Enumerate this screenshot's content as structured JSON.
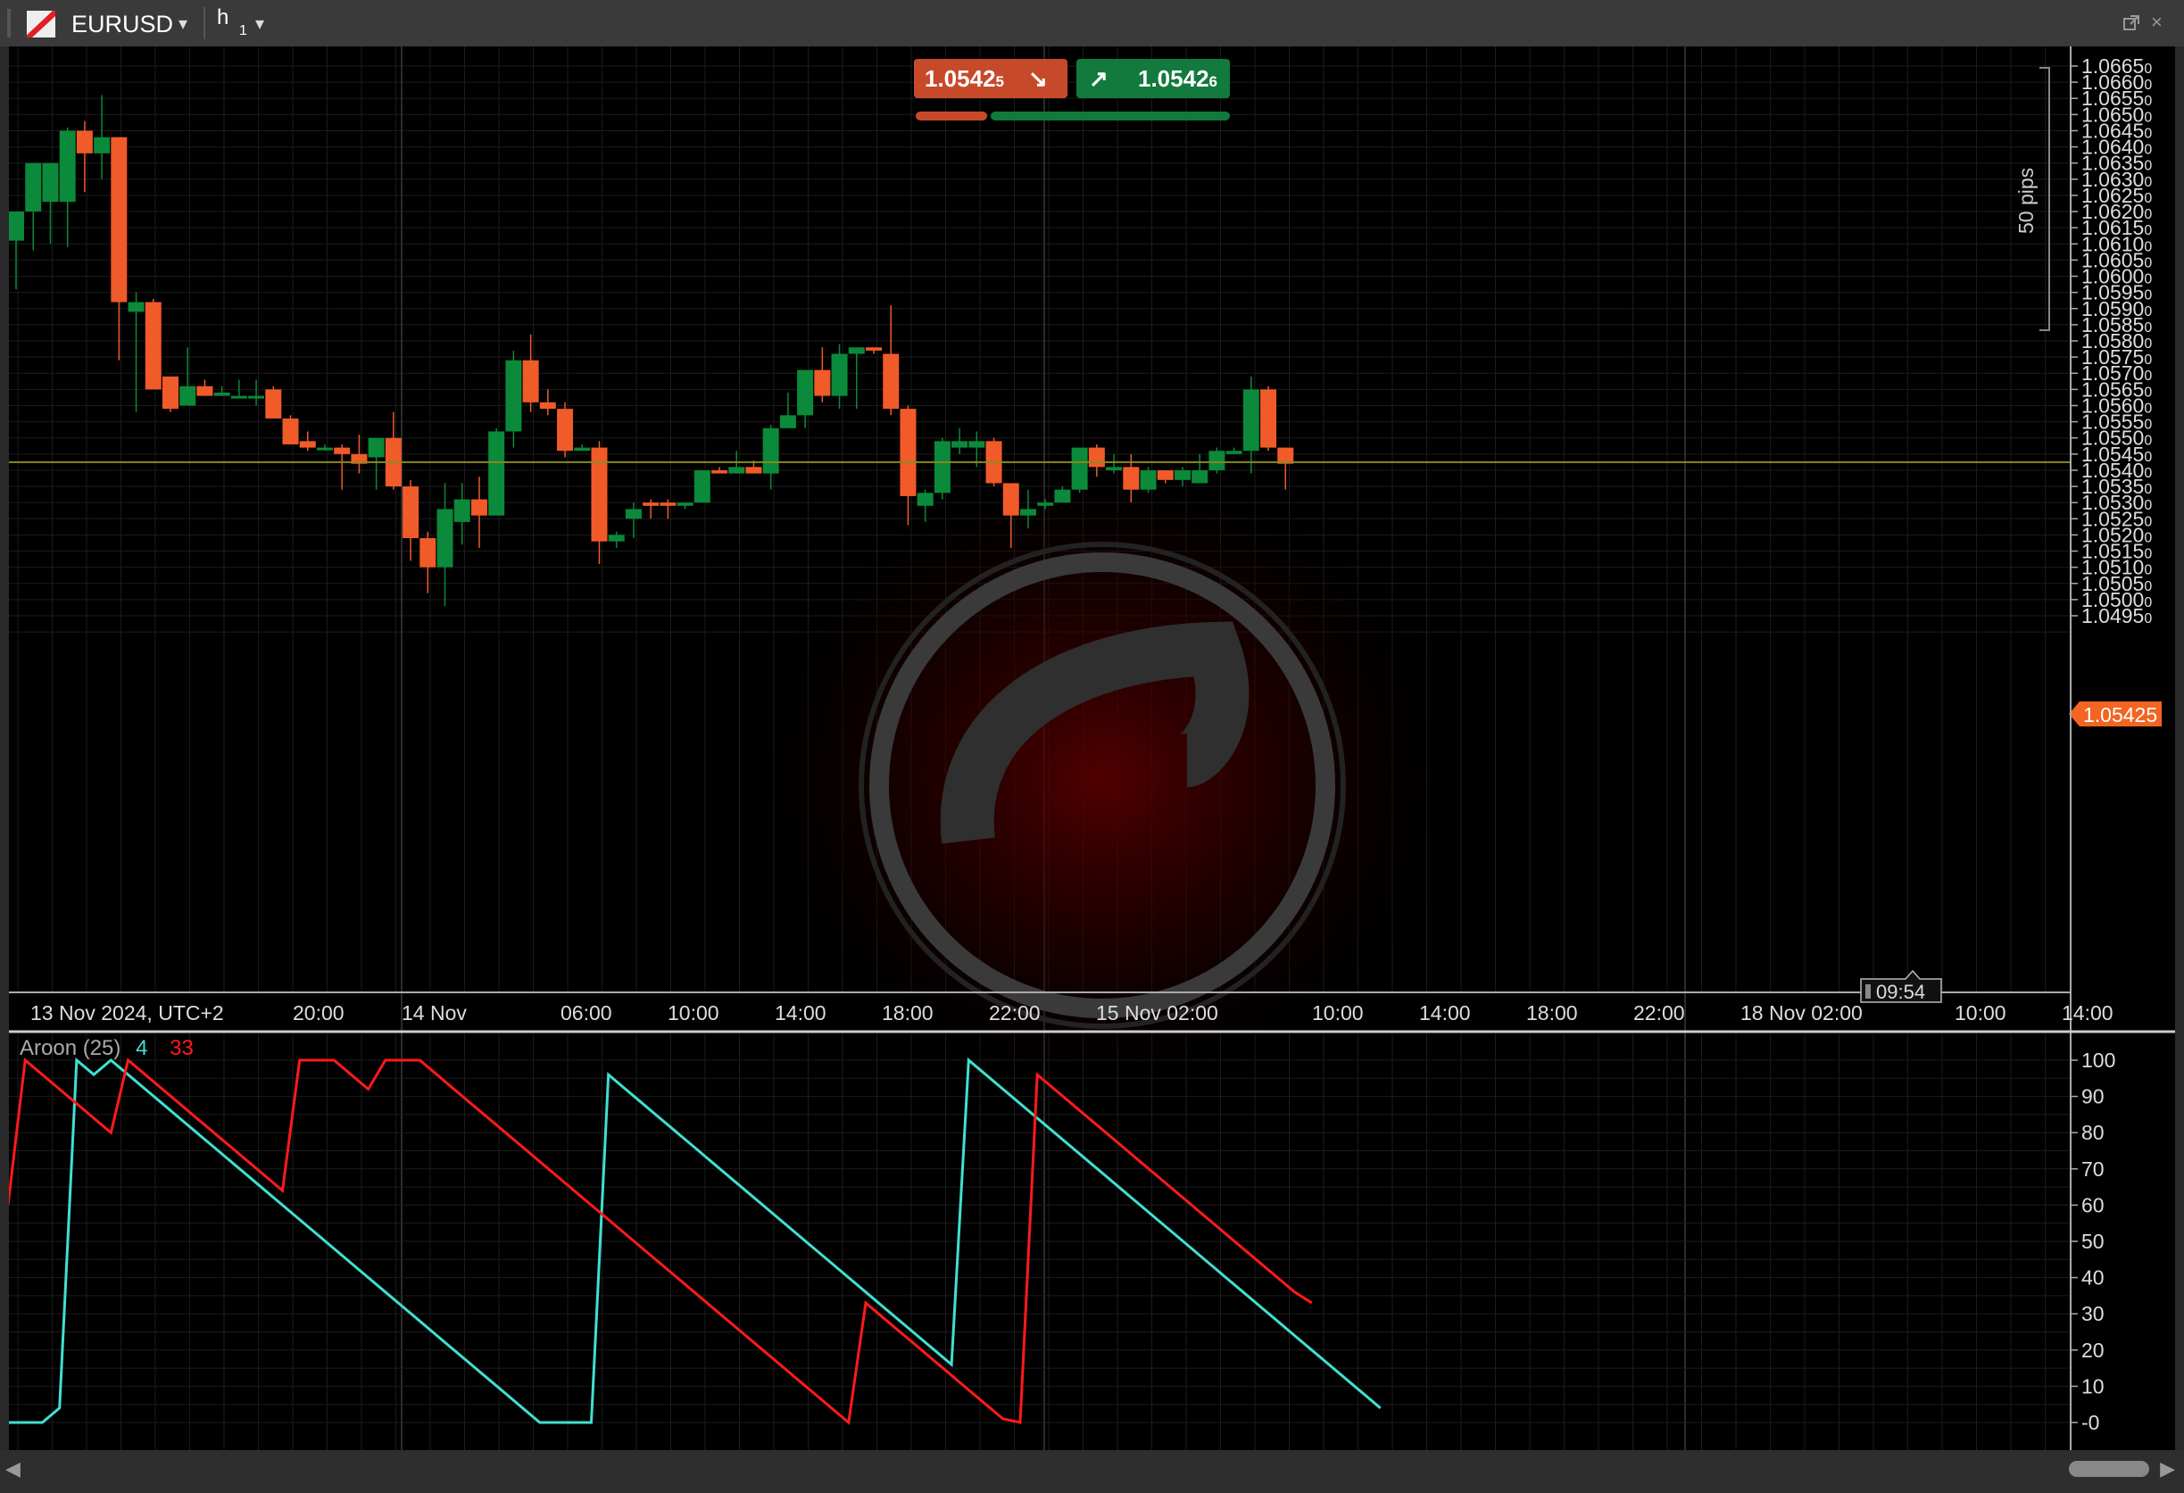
{
  "toolbar": {
    "symbol": "EURUSD",
    "timeframe": "h",
    "timeframe_sub": "1",
    "caret": "▾",
    "close": "×"
  },
  "quote": {
    "sell_price": "1.0542",
    "sell_pipette": "5",
    "buy_price": "1.0542",
    "buy_pipette": "6",
    "sell_arrow": "↘",
    "buy_arrow": "↗",
    "sell_color": "#c64a2a",
    "buy_color": "#127a3c"
  },
  "price_axis": {
    "labels": [
      "1.0665",
      "1.0660",
      "1.0655",
      "1.0650",
      "1.0645",
      "1.0640",
      "1.0635",
      "1.0630",
      "1.0625",
      "1.0620",
      "1.0615",
      "1.0610",
      "1.0605",
      "1.0600",
      "1.0595",
      "1.0590",
      "1.0585",
      "1.0580",
      "1.0575",
      "1.0570",
      "1.0565",
      "1.0560",
      "1.0555",
      "1.0550",
      "1.0545",
      "1.0540",
      "1.0535",
      "1.0530",
      "1.0525",
      "1.0520",
      "1.0515",
      "1.0510",
      "1.0505",
      "1.0500",
      "1.0495"
    ],
    "label_suffix": "0",
    "current_price": "1.05425",
    "current_color": "#f26522",
    "pips_label": "50 pips"
  },
  "time_axis": {
    "labels": [
      "13 Nov 2024, UTC+2",
      "20:00",
      "14 Nov",
      "06:00",
      "10:00",
      "14:00",
      "18:00",
      "22:00",
      "15 Nov 02:00",
      "10:00",
      "14:00",
      "18:00",
      "22:00",
      "18 Nov 02:00",
      "10:00",
      "14:00"
    ],
    "countdown": "09:54"
  },
  "indicator": {
    "name": "Aroon (25)",
    "up_value": "4",
    "down_value": "33",
    "up_color": "#40e0d0",
    "down_color": "#ff1a1a",
    "axis_labels": [
      "100",
      "90",
      "80",
      "70",
      "60",
      "50",
      "40",
      "30",
      "20",
      "10",
      "-0"
    ]
  },
  "chart_data": {
    "type": "candlestick",
    "symbol": "EURUSD",
    "timeframe": "h1",
    "up_color": "#0a8a3a",
    "down_color": "#f15a29",
    "ohlc": [
      [
        1.0611,
        1.062,
        1.0596,
        1.062
      ],
      [
        1.062,
        1.063,
        1.0608,
        1.0635
      ],
      [
        1.0623,
        1.0635,
        1.061,
        1.0635
      ],
      [
        1.0623,
        1.0646,
        1.0609,
        1.0645
      ],
      [
        1.0645,
        1.0648,
        1.0626,
        1.0638
      ],
      [
        1.0638,
        1.0656,
        1.063,
        1.0643
      ],
      [
        1.0643,
        1.0643,
        1.0574,
        1.0592
      ],
      [
        1.0589,
        1.0595,
        1.0558,
        1.0592
      ],
      [
        1.0592,
        1.0593,
        1.0567,
        1.0565
      ],
      [
        1.0569,
        1.0569,
        1.0558,
        1.0559
      ],
      [
        1.056,
        1.0578,
        1.056,
        1.0566
      ],
      [
        1.0566,
        1.0568,
        1.0563,
        1.0563
      ],
      [
        1.0563,
        1.0566,
        1.0563,
        1.0564
      ],
      [
        1.0563,
        1.0568,
        1.0563,
        1.0563
      ],
      [
        1.0563,
        1.0568,
        1.056,
        1.0563
      ],
      [
        1.0565,
        1.0566,
        1.0556,
        1.0556
      ],
      [
        1.0556,
        1.0557,
        1.0549,
        1.0548
      ],
      [
        1.0549,
        1.0552,
        1.0546,
        1.0547
      ],
      [
        1.0547,
        1.0548,
        1.0546,
        1.0547
      ],
      [
        1.0547,
        1.0548,
        1.0534,
        1.0545
      ],
      [
        1.0545,
        1.0551,
        1.0539,
        1.0542
      ],
      [
        1.0544,
        1.055,
        1.0534,
        1.055
      ],
      [
        1.055,
        1.0558,
        1.0534,
        1.0535
      ],
      [
        1.0535,
        1.0537,
        1.0512,
        1.0519
      ],
      [
        1.0519,
        1.0521,
        1.0502,
        1.051
      ],
      [
        1.051,
        1.0536,
        1.0498,
        1.0528
      ],
      [
        1.0524,
        1.0536,
        1.0517,
        1.0531
      ],
      [
        1.0531,
        1.0538,
        1.0516,
        1.0526
      ],
      [
        1.0526,
        1.0553,
        1.0526,
        1.0552
      ],
      [
        1.0552,
        1.0577,
        1.0547,
        1.0574
      ],
      [
        1.0574,
        1.0582,
        1.0558,
        1.0561
      ],
      [
        1.0561,
        1.0565,
        1.0557,
        1.0559
      ],
      [
        1.0559,
        1.0561,
        1.0544,
        1.0546
      ],
      [
        1.0546,
        1.0548,
        1.0546,
        1.0547
      ],
      [
        1.0547,
        1.0549,
        1.0511,
        1.0518
      ],
      [
        1.0518,
        1.0521,
        1.0516,
        1.052
      ],
      [
        1.0525,
        1.053,
        1.0519,
        1.0528
      ],
      [
        1.053,
        1.0531,
        1.0525,
        1.0529
      ],
      [
        1.053,
        1.0531,
        1.0525,
        1.0529
      ],
      [
        1.0529,
        1.053,
        1.0528,
        1.053
      ],
      [
        1.053,
        1.054,
        1.053,
        1.054
      ],
      [
        1.054,
        1.0541,
        1.0539,
        1.0539
      ],
      [
        1.0539,
        1.0546,
        1.0539,
        1.0541
      ],
      [
        1.0541,
        1.0543,
        1.0539,
        1.0539
      ],
      [
        1.0539,
        1.0554,
        1.0534,
        1.0553
      ],
      [
        1.0553,
        1.0564,
        1.0553,
        1.0557
      ],
      [
        1.0557,
        1.0571,
        1.0553,
        1.0571
      ],
      [
        1.0571,
        1.0578,
        1.0561,
        1.0563
      ],
      [
        1.0563,
        1.0579,
        1.0559,
        1.0576
      ],
      [
        1.0576,
        1.0578,
        1.0559,
        1.0578
      ],
      [
        1.0578,
        1.0578,
        1.0576,
        1.0577
      ],
      [
        1.0576,
        1.0591,
        1.0557,
        1.0559
      ],
      [
        1.0559,
        1.056,
        1.0523,
        1.0532
      ],
      [
        1.0529,
        1.0534,
        1.0524,
        1.0533
      ],
      [
        1.0533,
        1.055,
        1.0531,
        1.0549
      ],
      [
        1.0547,
        1.0553,
        1.0545,
        1.0549
      ],
      [
        1.0547,
        1.0552,
        1.0541,
        1.0549
      ],
      [
        1.0549,
        1.055,
        1.0535,
        1.0536
      ],
      [
        1.0536,
        1.0536,
        1.0516,
        1.0526
      ],
      [
        1.0526,
        1.0534,
        1.0522,
        1.0528
      ],
      [
        1.0529,
        1.0531,
        1.0528,
        1.053
      ],
      [
        1.053,
        1.0535,
        1.053,
        1.0534
      ],
      [
        1.0534,
        1.0547,
        1.0533,
        1.0547
      ],
      [
        1.0547,
        1.0548,
        1.0538,
        1.0541
      ],
      [
        1.054,
        1.0545,
        1.0539,
        1.0541
      ],
      [
        1.0541,
        1.0545,
        1.053,
        1.0534
      ],
      [
        1.0534,
        1.0541,
        1.0533,
        1.054
      ],
      [
        1.054,
        1.054,
        1.0536,
        1.0537
      ],
      [
        1.0537,
        1.0541,
        1.0535,
        1.054
      ],
      [
        1.0536,
        1.0545,
        1.0536,
        1.054
      ],
      [
        1.054,
        1.0547,
        1.0539,
        1.0546
      ],
      [
        1.0545,
        1.0547,
        1.0545,
        1.0546
      ],
      [
        1.0546,
        1.0569,
        1.0539,
        1.0565
      ],
      [
        1.0565,
        1.0566,
        1.0546,
        1.0547
      ],
      [
        1.0547,
        1.0547,
        1.0534,
        1.0542
      ]
    ],
    "aroon_up": [
      0,
      0,
      0,
      4,
      100,
      96,
      100,
      96,
      92,
      88,
      84,
      80,
      76,
      72,
      68,
      64,
      60,
      56,
      52,
      48,
      44,
      40,
      36,
      32,
      28,
      24,
      20,
      16,
      12,
      8,
      4,
      0,
      0,
      0,
      0,
      96,
      92,
      88,
      84,
      80,
      76,
      72,
      68,
      64,
      60,
      56,
      52,
      48,
      44,
      40,
      36,
      32,
      28,
      24,
      20,
      16,
      100,
      96,
      92,
      88,
      84,
      80,
      76,
      72,
      68,
      64,
      60,
      56,
      52,
      48,
      44,
      40,
      36,
      32,
      28,
      24,
      20,
      16,
      12,
      8,
      4
    ],
    "aroon_down": [
      60,
      100,
      96,
      92,
      88,
      84,
      80,
      100,
      96,
      92,
      88,
      84,
      80,
      76,
      72,
      68,
      64,
      100,
      100,
      100,
      96,
      92,
      100,
      100,
      100,
      96,
      92,
      88,
      84,
      80,
      76,
      72,
      68,
      64,
      60,
      56,
      52,
      48,
      44,
      40,
      36,
      32,
      28,
      24,
      20,
      16,
      12,
      8,
      4,
      0,
      33,
      29,
      25,
      21,
      17,
      13,
      9,
      5,
      1,
      0,
      96,
      92,
      88,
      84,
      80,
      76,
      72,
      68,
      64,
      60,
      56,
      52,
      48,
      44,
      40,
      36,
      33
    ],
    "current_price": 1.05425,
    "ylim_price": [
      1.0492,
      1.067
    ],
    "ylim_aroon": [
      0,
      100
    ]
  }
}
